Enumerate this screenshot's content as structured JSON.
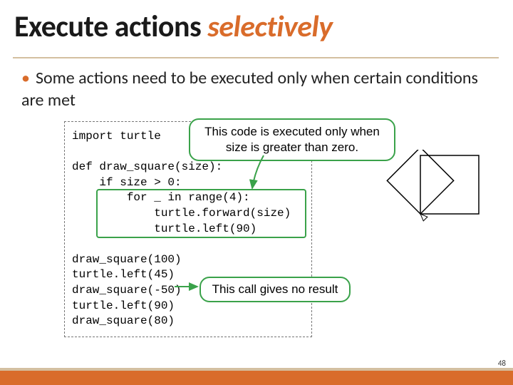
{
  "title": {
    "main": "Execute actions ",
    "emph": "selectively"
  },
  "bullet": "Some actions need to be executed only when certain conditions are met",
  "code": "import turtle\n\ndef draw_square(size):\n    if size > 0:\n        for _ in range(4):\n            turtle.forward(size)\n            turtle.left(90)\n\ndraw_square(100)\nturtle.left(45)\ndraw_square(-50)\nturtle.left(90)\ndraw_square(80)",
  "callouts": {
    "top": "This code is executed only when\nsize is greater than zero.",
    "bottom": "This call gives no result"
  },
  "page_number": "48"
}
